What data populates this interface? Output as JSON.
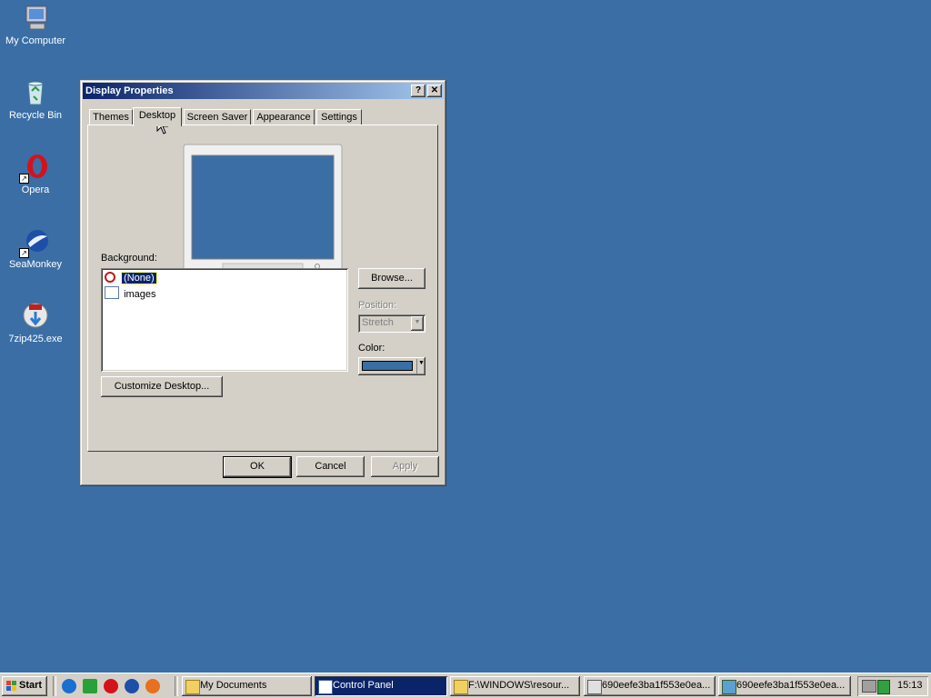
{
  "desktop": {
    "background_color": "#3a6ea5",
    "icons": [
      {
        "label": "My Computer",
        "icon": "computer-icon"
      },
      {
        "label": "Recycle Bin",
        "icon": "recycle-bin-icon"
      },
      {
        "label": "Opera",
        "icon": "opera-icon"
      },
      {
        "label": "SeaMonkey",
        "icon": "seamonkey-icon"
      },
      {
        "label": "7zip425.exe",
        "icon": "installer-icon"
      }
    ]
  },
  "dialog": {
    "title": "Display Properties",
    "help_button": "?",
    "close_button": "✕",
    "tabs": [
      {
        "label": "Themes"
      },
      {
        "label": "Desktop",
        "active": true
      },
      {
        "label": "Screen Saver"
      },
      {
        "label": "Appearance"
      },
      {
        "label": "Settings"
      }
    ],
    "background_label": "Background:",
    "background_items": [
      {
        "label": "(None)",
        "icon": "none-icon",
        "selected": true
      },
      {
        "label": "images",
        "icon": "image-file-icon"
      }
    ],
    "browse_button": "Browse...",
    "position_label": "Position:",
    "position_value": "Stretch",
    "color_label": "Color:",
    "color_value": "#3a6ea5",
    "customize_button": "Customize Desktop...",
    "ok_button": "OK",
    "cancel_button": "Cancel",
    "apply_button": "Apply"
  },
  "taskbar": {
    "start_label": "Start",
    "quick_launch": [
      "ie-icon",
      "show-desktop-icon",
      "opera-icon",
      "seamonkey-icon",
      "firefox-icon"
    ],
    "items": [
      {
        "label": "My Documents",
        "icon": "folder-icon",
        "active": false
      },
      {
        "label": "Control Panel",
        "icon": "control-panel-icon",
        "active": true
      },
      {
        "label": "F:\\WINDOWS\\resour...",
        "icon": "folder-icon",
        "active": false
      },
      {
        "label": "690eefe3ba1f553e0ea...",
        "icon": "image-viewer-icon",
        "active": false
      },
      {
        "label": "690eefe3ba1f553e0ea...",
        "icon": "image-viewer-icon",
        "active": false
      }
    ],
    "clock": "15:13"
  }
}
